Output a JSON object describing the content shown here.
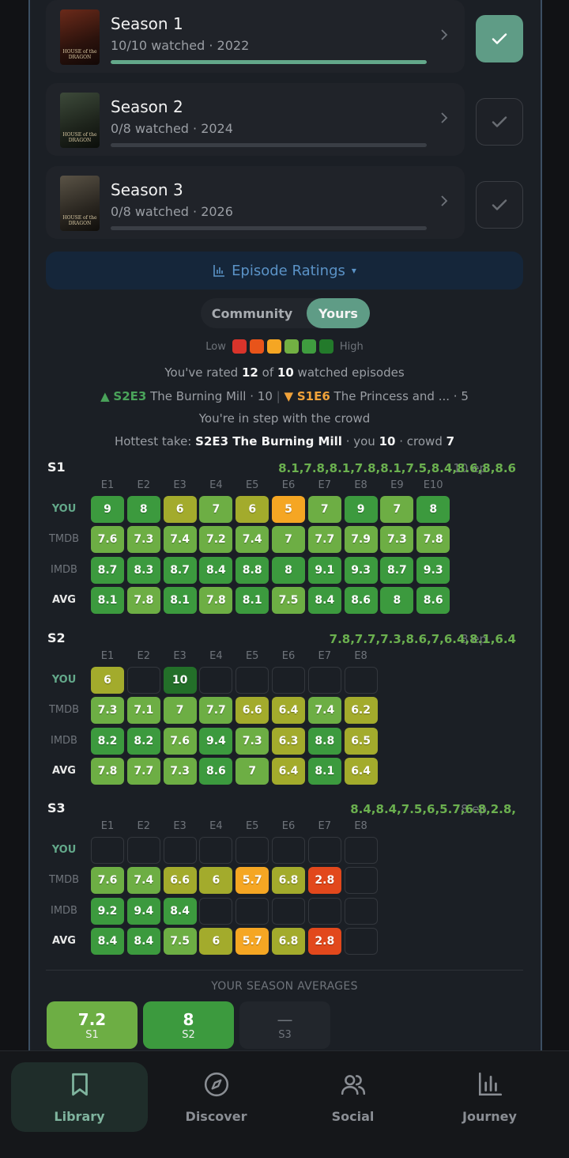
{
  "seasons": [
    {
      "title": "Season 1",
      "subtitle": "10/10 watched · 2022",
      "progress": 1.0,
      "complete": true,
      "poster_text": "HOUSE of the DRAGON"
    },
    {
      "title": "Season 2",
      "subtitle": "0/8 watched · 2024",
      "progress": 0.0,
      "complete": false,
      "poster_text": "HOUSE of the DRAGON"
    },
    {
      "title": "Season 3",
      "subtitle": "0/8 watched · 2026",
      "progress": 0.0,
      "complete": false,
      "poster_text": "HOUSE of the DRAGON"
    }
  ],
  "ratings_button": {
    "label": "Episode Ratings",
    "caret": "▾",
    "icon": "bar-chart-icon"
  },
  "toggle": {
    "community": "Community",
    "yours": "Yours",
    "selected": "yours"
  },
  "legend": {
    "low": "Low",
    "high": "High",
    "colors": [
      "#d9342b",
      "#e8541a",
      "#f5a623",
      "#72b043",
      "#3f9c3f",
      "#237a2b"
    ]
  },
  "stats": {
    "rated_prefix": "You've rated",
    "rated_count": "12",
    "rated_mid": "of",
    "watched_count": "10",
    "rated_suffix": "watched episodes",
    "up_code": "S2E3",
    "up_title": "The Burning Mill",
    "up_score": "10",
    "down_code": "S1E6",
    "down_title": "The Princess and ...",
    "down_score": "5",
    "crowd_line": "You're in step with the crowd",
    "hot_prefix": "Hottest take:",
    "hot_episode": "S2E3 The Burning Mill",
    "hot_you_label": "· you",
    "hot_you": "10",
    "hot_crowd_label": "· crowd",
    "hot_crowd": "7"
  },
  "row_labels": {
    "you": "YOU",
    "tmdb": "TMDB",
    "imdb": "IMDB",
    "avg": "AVG"
  },
  "grid": [
    {
      "label": "S1",
      "meta": "10 ep",
      "avg": [
        8.1,
        7.8,
        8.1,
        7.8,
        8.1,
        7.5,
        8.4,
        8.6,
        8,
        8.6
      ],
      "episodes": [
        "E1",
        "E2",
        "E3",
        "E4",
        "E5",
        "E6",
        "E7",
        "E8",
        "E9",
        "E10"
      ],
      "you": [
        9,
        8,
        6,
        7,
        6,
        5,
        7,
        9,
        7,
        8
      ],
      "tmdb": [
        7.6,
        7.3,
        7.4,
        7.2,
        7.4,
        7,
        7.7,
        7.9,
        7.3,
        7.8
      ],
      "imdb": [
        8.7,
        8.3,
        8.7,
        8.4,
        8.8,
        8,
        9.1,
        9.3,
        8.7,
        9.3
      ]
    },
    {
      "label": "S2",
      "meta": "8 ep",
      "avg": [
        7.8,
        7.7,
        7.3,
        8.6,
        7,
        6.4,
        8.1,
        6.4
      ],
      "episodes": [
        "E1",
        "E2",
        "E3",
        "E4",
        "E5",
        "E6",
        "E7",
        "E8"
      ],
      "you": [
        6,
        null,
        10,
        null,
        null,
        null,
        null,
        null
      ],
      "tmdb": [
        7.3,
        7.1,
        7,
        7.7,
        6.6,
        6.4,
        7.4,
        6.2
      ],
      "imdb": [
        8.2,
        8.2,
        7.6,
        9.4,
        7.3,
        6.3,
        8.8,
        6.5
      ]
    },
    {
      "label": "S3",
      "meta": "8 ep",
      "avg": [
        8.4,
        8.4,
        7.5,
        6,
        5.7,
        6.8,
        2.8,
        null
      ],
      "episodes": [
        "E1",
        "E2",
        "E3",
        "E4",
        "E5",
        "E6",
        "E7",
        "E8"
      ],
      "you": [
        null,
        null,
        null,
        null,
        null,
        null,
        null,
        null
      ],
      "tmdb": [
        7.6,
        7.4,
        6.6,
        6,
        5.7,
        6.8,
        2.8,
        null
      ],
      "imdb": [
        9.2,
        9.4,
        8.4,
        null,
        null,
        null,
        null,
        null
      ]
    }
  ],
  "season_averages": {
    "title": "YOUR SEASON AVERAGES",
    "items": [
      {
        "value": "7.2",
        "label": "S1"
      },
      {
        "value": "8",
        "label": "S2"
      },
      {
        "value": "—",
        "label": "S3"
      }
    ]
  },
  "nav": [
    {
      "label": "Library",
      "icon": "bookmark-icon",
      "active": true
    },
    {
      "label": "Discover",
      "icon": "compass-icon",
      "active": false
    },
    {
      "label": "Social",
      "icon": "users-icon",
      "active": false
    },
    {
      "label": "Journey",
      "icon": "bar-chart-icon",
      "active": false
    }
  ]
}
